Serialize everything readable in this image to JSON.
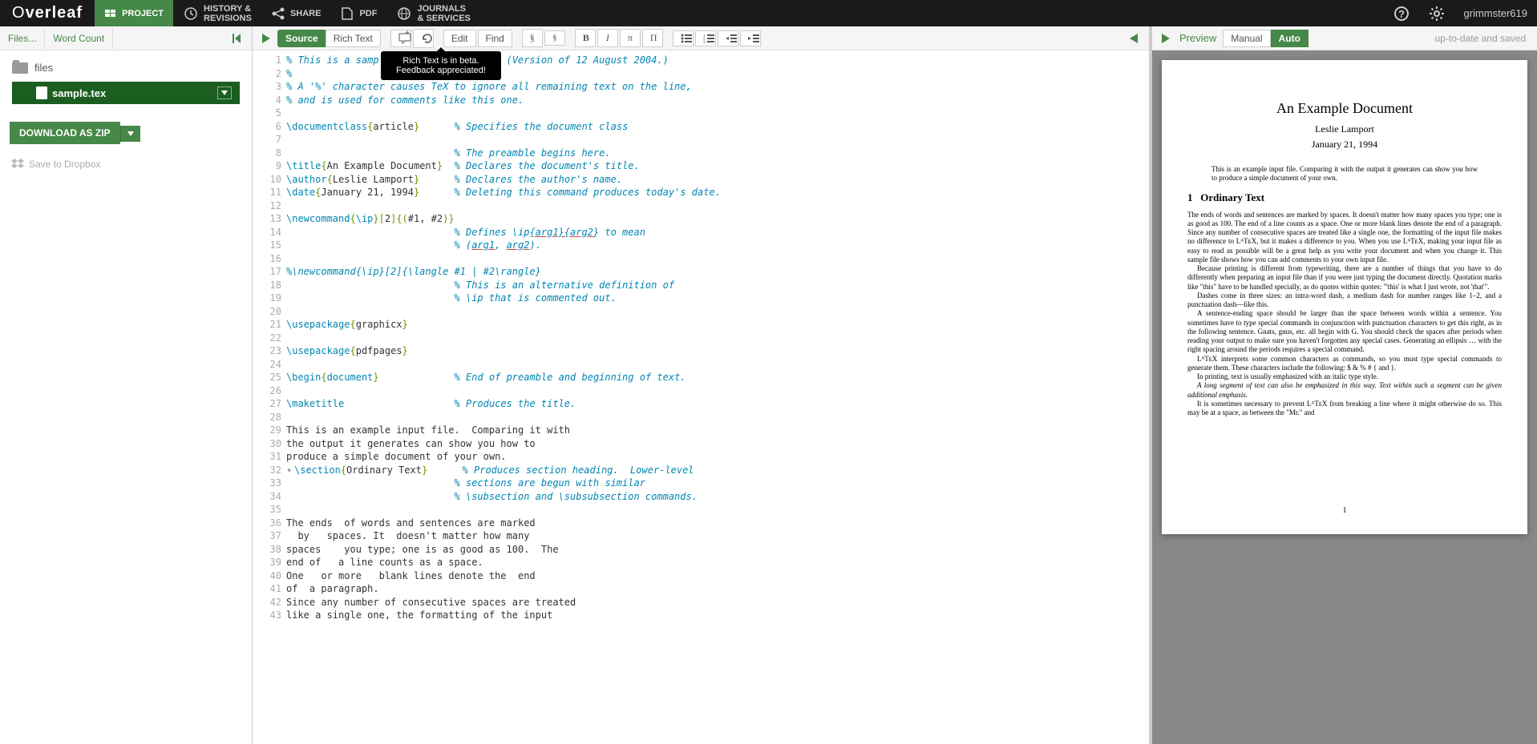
{
  "brand": {
    "part1": "O",
    "part2": "verleaf"
  },
  "topbar": {
    "project": "PROJECT",
    "history": "HISTORY &",
    "history2": "REVISIONS",
    "share": "SHARE",
    "pdf": "PDF",
    "journals": "JOURNALS",
    "journals2": "& SERVICES",
    "username": "grimmster619"
  },
  "sidebar": {
    "tab_files": "Files...",
    "tab_wc": "Word Count",
    "root": "files",
    "file": "sample.tex",
    "download": "DOWNLOAD AS ZIP",
    "dropbox": "Save to Dropbox"
  },
  "editor": {
    "source": "Source",
    "rich": "Rich Text",
    "edit": "Edit",
    "find": "Find",
    "tooltip": "Rich Text is in beta. Feedback appreciated!",
    "lines": [
      {
        "n": 1,
        "seg": [
          {
            "t": "% This is a sample LaTeX input file.  (Version of 12 August 2004.)",
            "c": "c-comment"
          }
        ]
      },
      {
        "n": 2,
        "seg": [
          {
            "t": "%",
            "c": "c-comment"
          }
        ]
      },
      {
        "n": 3,
        "seg": [
          {
            "t": "% A '%' character causes TeX to ignore all remaining text on the line,",
            "c": "c-comment"
          }
        ]
      },
      {
        "n": 4,
        "seg": [
          {
            "t": "% and is used for comments like this one.",
            "c": "c-comment"
          }
        ]
      },
      {
        "n": 5,
        "seg": []
      },
      {
        "n": 6,
        "seg": [
          {
            "t": "\\documentclass",
            "c": "c-cmd"
          },
          {
            "t": "{",
            "c": "c-brace"
          },
          {
            "t": "article",
            "c": "c-arg"
          },
          {
            "t": "}",
            "c": "c-brace"
          },
          {
            "t": "      ",
            "c": ""
          },
          {
            "t": "% Specifies the document class",
            "c": "c-comment"
          }
        ]
      },
      {
        "n": 7,
        "seg": []
      },
      {
        "n": 8,
        "seg": [
          {
            "t": "                             ",
            "c": ""
          },
          {
            "t": "% The preamble begins here.",
            "c": "c-comment"
          }
        ]
      },
      {
        "n": 9,
        "seg": [
          {
            "t": "\\title",
            "c": "c-cmd"
          },
          {
            "t": "{",
            "c": "c-brace"
          },
          {
            "t": "An Example Document",
            "c": "c-arg"
          },
          {
            "t": "}",
            "c": "c-brace"
          },
          {
            "t": "  ",
            "c": ""
          },
          {
            "t": "% Declares the document's title.",
            "c": "c-comment"
          }
        ]
      },
      {
        "n": 10,
        "seg": [
          {
            "t": "\\author",
            "c": "c-cmd"
          },
          {
            "t": "{",
            "c": "c-brace"
          },
          {
            "t": "Leslie Lamport",
            "c": "c-arg"
          },
          {
            "t": "}",
            "c": "c-brace"
          },
          {
            "t": "      ",
            "c": ""
          },
          {
            "t": "% Declares the author's name.",
            "c": "c-comment"
          }
        ]
      },
      {
        "n": 11,
        "seg": [
          {
            "t": "\\date",
            "c": "c-cmd"
          },
          {
            "t": "{",
            "c": "c-brace"
          },
          {
            "t": "January 21, 1994",
            "c": "c-arg"
          },
          {
            "t": "}",
            "c": "c-brace"
          },
          {
            "t": "      ",
            "c": ""
          },
          {
            "t": "% Deleting this command produces today's date.",
            "c": "c-comment"
          }
        ]
      },
      {
        "n": 12,
        "seg": []
      },
      {
        "n": 13,
        "seg": [
          {
            "t": "\\newcommand",
            "c": "c-cmd"
          },
          {
            "t": "{",
            "c": "c-brace"
          },
          {
            "t": "\\ip",
            "c": "c-cmd"
          },
          {
            "t": "}[",
            "c": "c-brace"
          },
          {
            "t": "2",
            "c": "c-arg"
          },
          {
            "t": "]{(",
            "c": "c-brace"
          },
          {
            "t": "#1, #2",
            "c": "c-arg"
          },
          {
            "t": ")}",
            "c": "c-brace"
          }
        ]
      },
      {
        "n": 14,
        "seg": [
          {
            "t": "                             ",
            "c": ""
          },
          {
            "t": "% Defines \\ip",
            "c": "c-comment"
          },
          {
            "t": "{arg1}{arg2",
            "c": "c-comment c-ul"
          },
          {
            "t": "} to mean",
            "c": "c-comment"
          }
        ]
      },
      {
        "n": 15,
        "seg": [
          {
            "t": "                             ",
            "c": ""
          },
          {
            "t": "% (",
            "c": "c-comment"
          },
          {
            "t": "arg1",
            "c": "c-comment c-ul"
          },
          {
            "t": ", ",
            "c": "c-comment"
          },
          {
            "t": "arg2",
            "c": "c-comment c-ul"
          },
          {
            "t": ").",
            "c": "c-comment"
          }
        ]
      },
      {
        "n": 16,
        "seg": []
      },
      {
        "n": 17,
        "seg": [
          {
            "t": "%\\newcommand{\\ip}[2]{\\langle #1 | #2\\rangle}",
            "c": "c-comment"
          }
        ]
      },
      {
        "n": 18,
        "seg": [
          {
            "t": "                             ",
            "c": ""
          },
          {
            "t": "% This is an alternative definition of",
            "c": "c-comment"
          }
        ]
      },
      {
        "n": 19,
        "seg": [
          {
            "t": "                             ",
            "c": ""
          },
          {
            "t": "% \\ip that is commented out.",
            "c": "c-comment"
          }
        ]
      },
      {
        "n": 20,
        "seg": []
      },
      {
        "n": 21,
        "seg": [
          {
            "t": "\\usepackage",
            "c": "c-cmd"
          },
          {
            "t": "{",
            "c": "c-brace"
          },
          {
            "t": "graphicx",
            "c": "c-arg"
          },
          {
            "t": "}",
            "c": "c-brace"
          }
        ]
      },
      {
        "n": 22,
        "seg": []
      },
      {
        "n": 23,
        "seg": [
          {
            "t": "\\usepackage",
            "c": "c-cmd"
          },
          {
            "t": "{",
            "c": "c-brace"
          },
          {
            "t": "pdfpages",
            "c": "c-arg"
          },
          {
            "t": "}",
            "c": "c-brace"
          }
        ]
      },
      {
        "n": 24,
        "seg": []
      },
      {
        "n": 25,
        "seg": [
          {
            "t": "\\begin",
            "c": "c-cmd"
          },
          {
            "t": "{",
            "c": "c-brace"
          },
          {
            "t": "document",
            "c": "c-cmd"
          },
          {
            "t": "}",
            "c": "c-brace"
          },
          {
            "t": "             ",
            "c": ""
          },
          {
            "t": "% End of preamble and beginning of text.",
            "c": "c-comment"
          }
        ]
      },
      {
        "n": 26,
        "seg": []
      },
      {
        "n": 27,
        "seg": [
          {
            "t": "\\maketitle",
            "c": "c-cmd"
          },
          {
            "t": "                   ",
            "c": ""
          },
          {
            "t": "% Produces the title.",
            "c": "c-comment"
          }
        ]
      },
      {
        "n": 28,
        "seg": []
      },
      {
        "n": 29,
        "seg": [
          {
            "t": "This is an example input file.  Comparing it with",
            "c": "c-arg"
          }
        ]
      },
      {
        "n": 30,
        "seg": [
          {
            "t": "the output it generates can show you how to",
            "c": "c-arg"
          }
        ]
      },
      {
        "n": 31,
        "seg": [
          {
            "t": "produce a simple document of your own.",
            "c": "c-arg"
          }
        ]
      },
      {
        "n": 32,
        "fold": true,
        "seg": [
          {
            "t": "\\section",
            "c": "c-cmd"
          },
          {
            "t": "{",
            "c": "c-brace"
          },
          {
            "t": "Ordinary Text",
            "c": "c-arg"
          },
          {
            "t": "}",
            "c": "c-brace"
          },
          {
            "t": "      ",
            "c": ""
          },
          {
            "t": "% Produces section heading.  Lower-level",
            "c": "c-comment"
          }
        ]
      },
      {
        "n": 33,
        "seg": [
          {
            "t": "                             ",
            "c": ""
          },
          {
            "t": "% sections are begun with similar",
            "c": "c-comment"
          }
        ]
      },
      {
        "n": 34,
        "seg": [
          {
            "t": "                             ",
            "c": ""
          },
          {
            "t": "% \\subsection and \\subsubsection commands.",
            "c": "c-comment"
          }
        ]
      },
      {
        "n": 35,
        "seg": []
      },
      {
        "n": 36,
        "seg": [
          {
            "t": "The ends  of words and sentences are marked",
            "c": "c-arg"
          }
        ]
      },
      {
        "n": 37,
        "seg": [
          {
            "t": "  by   spaces. It  doesn't matter how many",
            "c": "c-arg"
          }
        ]
      },
      {
        "n": 38,
        "seg": [
          {
            "t": "spaces    you type; one is as good as 100.  The",
            "c": "c-arg"
          }
        ]
      },
      {
        "n": 39,
        "seg": [
          {
            "t": "end of   a line counts as a space.",
            "c": "c-arg"
          }
        ]
      },
      {
        "n": 40,
        "seg": [
          {
            "t": "One   or more   blank lines denote the  end",
            "c": "c-arg"
          }
        ]
      },
      {
        "n": 41,
        "seg": [
          {
            "t": "of  a paragraph.",
            "c": "c-arg"
          }
        ]
      },
      {
        "n": 42,
        "seg": [
          {
            "t": "Since any number of consecutive spaces are treated",
            "c": "c-arg"
          }
        ]
      },
      {
        "n": 43,
        "seg": [
          {
            "t": "like a single one, the formatting of the input",
            "c": "c-arg"
          }
        ]
      }
    ]
  },
  "preview": {
    "preview": "Preview",
    "manual": "Manual",
    "auto": "Auto",
    "status": "up-to-date and saved",
    "doc": {
      "title": "An Example Document",
      "author": "Leslie Lamport",
      "date": "January 21, 1994",
      "abstract": "This is an example input file. Comparing it with the output it generates can show you how to produce a simple document of your own.",
      "section_num": "1",
      "section_title": "Ordinary Text",
      "p1": "The ends of words and sentences are marked by spaces. It doesn't matter how many spaces you type; one is as good as 100. The end of a line counts as a space. One or more blank lines denote the end of a paragraph. Since any number of consecutive spaces are treated like a single one, the formatting of the input file makes no difference to LᴬTᴇX, but it makes a difference to you. When you use LᴬTᴇX, making your input file as easy to read as possible will be a great help as you write your document and when you change it. This sample file shows how you can add comments to your own input file.",
      "p2": "Because printing is different from typewriting, there are a number of things that you have to do differently when preparing an input file than if you were just typing the document directly. Quotation marks like \"this\" have to be handled specially, as do quotes within quotes: \"'this' is what I just wrote, not 'that'\".",
      "p3": "Dashes come in three sizes: an intra-word dash, a medium dash for number ranges like 1–2, and a punctuation dash—like this.",
      "p4": "A sentence-ending space should be larger than the space between words within a sentence. You sometimes have to type special commands in conjunction with punctuation characters to get this right, as in the following sentence. Gnats, gnus, etc. all begin with G. You should check the spaces after periods when reading your output to make sure you haven't forgotten any special cases. Generating an ellipsis … with the right spacing around the periods requires a special command.",
      "p5": "LᴬTᴇX interprets some common characters as commands, so you must type special commands to generate them. These characters include the following: $ & % # { and }.",
      "p6": "In printing, text is usually emphasized with an italic type style.",
      "p7": "A long segment of text can also be emphasized in this way. Text within such a segment can be given additional emphasis.",
      "p8": "It is sometimes necessary to prevent LᴬTᴇX from breaking a line where it might otherwise do so. This may be at a space, as between the \"Mr.\" and",
      "pagenum": "1"
    }
  }
}
